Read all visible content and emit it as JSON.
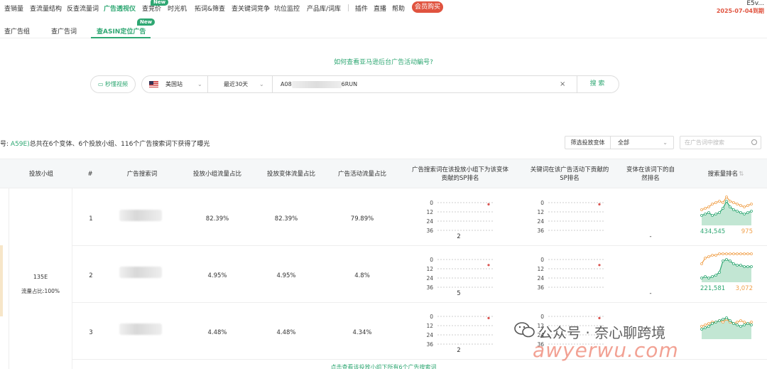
{
  "nav": {
    "items": [
      "查销量",
      "查流量结构",
      "反查流量词",
      "广告透视仪",
      "查竞价",
      "时光机",
      "拓词&筛查",
      "查关键词竞争",
      "坑位监控",
      "产品库/词库",
      "插件",
      "直播",
      "帮助"
    ],
    "active_index": 3,
    "new_badge": "New",
    "vip_button": "会员购买",
    "user_name": "E5v...",
    "expiry": "2025-07-04到期"
  },
  "subtabs": {
    "items": [
      "查广告组",
      "查广告词",
      "查ASIN定位广告"
    ],
    "active_index": 2,
    "new_badge": "New"
  },
  "help_link": "如何查看亚马逊后台广告活动編号?",
  "search": {
    "video_button": "秒懂视频",
    "marketplace": "美国站",
    "date_range": "最近30天",
    "query_prefix": "A08",
    "query_suffix": "6RUN",
    "clear_icon": "×",
    "search_button": "搜 索"
  },
  "summary": {
    "prefix": "号: ",
    "highlight": "A59E)",
    "text": "总共在6个变体、6个投放小组、116个广告搜索词下获得了曝光"
  },
  "filters": {
    "label": "筛选投放变体",
    "selected": "全部",
    "search_placeholder": "在广告词中搜索"
  },
  "columns": [
    "投放小组",
    "#",
    "广告搜索词",
    "投放小组流量占比",
    "投放变体流量占比",
    "广告活动流量占比",
    "广告搜索词在该投放小组下为该变体贡献的SP排名",
    "关键词在该广告活动下贡献的SP排名",
    "变体在该词下的自然排名",
    "搜索量排名"
  ],
  "group": {
    "name": "135E",
    "share": "流量占比:100%"
  },
  "rows": [
    {
      "index": "1",
      "group_share": "82.39%",
      "variant_share": "82.39%",
      "campaign_share": "79.89%",
      "sp_rank_label": "2",
      "natural": "-",
      "search_volume": "434,545",
      "search_rank": "975"
    },
    {
      "index": "2",
      "group_share": "4.95%",
      "variant_share": "4.95%",
      "campaign_share": "4.8%",
      "sp_rank_label": "5",
      "natural": "-",
      "search_volume": "221,581",
      "search_rank": "3,072"
    },
    {
      "index": "3",
      "group_share": "4.48%",
      "variant_share": "4.48%",
      "campaign_share": "4.34%",
      "sp_rank_label": "2",
      "natural": "",
      "search_volume": "",
      "search_rank": ""
    }
  ],
  "rank_axis_ticks": [
    "0",
    "12",
    "24",
    "36"
  ],
  "footer_link": "点击查看该投放小组下所有6个广告搜索词",
  "watermark": {
    "text": "公众号 · 奈心聊跨境",
    "site": "awyerwu.com"
  },
  "colors": {
    "accent": "#2ea772",
    "danger": "#e0533f",
    "orange": "#f0a04b"
  }
}
